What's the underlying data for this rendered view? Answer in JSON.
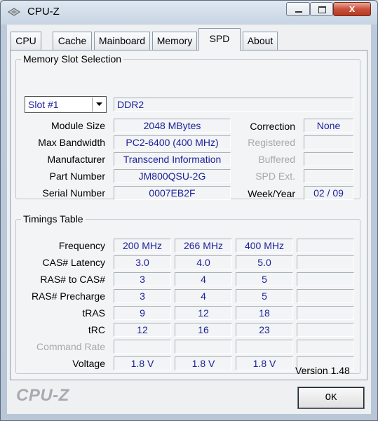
{
  "window": {
    "title": "CPU-Z",
    "close_glyph": "x"
  },
  "tabs": [
    {
      "label": "CPU",
      "active": false
    },
    {
      "label": "Cache",
      "active": false
    },
    {
      "label": "Mainboard",
      "active": false
    },
    {
      "label": "Memory",
      "active": false
    },
    {
      "label": "SPD",
      "active": true
    },
    {
      "label": "About",
      "active": false
    }
  ],
  "slot_selection": {
    "group_title": "Memory Slot Selection",
    "selected_slot": "Slot #1",
    "memory_type": "DDR2",
    "fields": {
      "module_size": {
        "label": "Module Size",
        "value": "2048 MBytes"
      },
      "max_bandwidth": {
        "label": "Max Bandwidth",
        "value": "PC2-6400 (400 MHz)"
      },
      "manufacturer": {
        "label": "Manufacturer",
        "value": "Transcend Information"
      },
      "part_number": {
        "label": "Part Number",
        "value": "JM800QSU-2G"
      },
      "serial_number": {
        "label": "Serial Number",
        "value": "0007EB2F"
      }
    },
    "right_fields": {
      "correction": {
        "label": "Correction",
        "value": "None"
      },
      "registered": {
        "label": "Registered",
        "value": ""
      },
      "buffered": {
        "label": "Buffered",
        "value": ""
      },
      "spd_ext": {
        "label": "SPD Ext.",
        "value": ""
      },
      "week_year": {
        "label": "Week/Year",
        "value": "02 / 09"
      }
    }
  },
  "timings": {
    "group_title": "Timings Table",
    "rows": [
      {
        "label": "Frequency",
        "values": [
          "200 MHz",
          "266 MHz",
          "400 MHz",
          ""
        ]
      },
      {
        "label": "CAS# Latency",
        "values": [
          "3.0",
          "4.0",
          "5.0",
          ""
        ]
      },
      {
        "label": "RAS# to CAS#",
        "values": [
          "3",
          "4",
          "5",
          ""
        ]
      },
      {
        "label": "RAS# Precharge",
        "values": [
          "3",
          "4",
          "5",
          ""
        ]
      },
      {
        "label": "tRAS",
        "values": [
          "9",
          "12",
          "18",
          ""
        ]
      },
      {
        "label": "tRC",
        "values": [
          "12",
          "16",
          "23",
          ""
        ]
      },
      {
        "label": "Command Rate",
        "values": [
          "",
          "",
          "",
          ""
        ]
      },
      {
        "label": "Voltage",
        "values": [
          "1.8 V",
          "1.8 V",
          "1.8 V",
          ""
        ]
      }
    ]
  },
  "footer": {
    "version": "Version 1.48",
    "logo": "CPU-Z",
    "ok_label": "OK"
  },
  "colors": {
    "value_text": "#1a1f9a",
    "disabled_label": "#a7a9ab",
    "close_button": "#c9503a"
  },
  "icons": {
    "app": "cpu-chip-icon",
    "dropdown": "chevron-down-icon"
  }
}
